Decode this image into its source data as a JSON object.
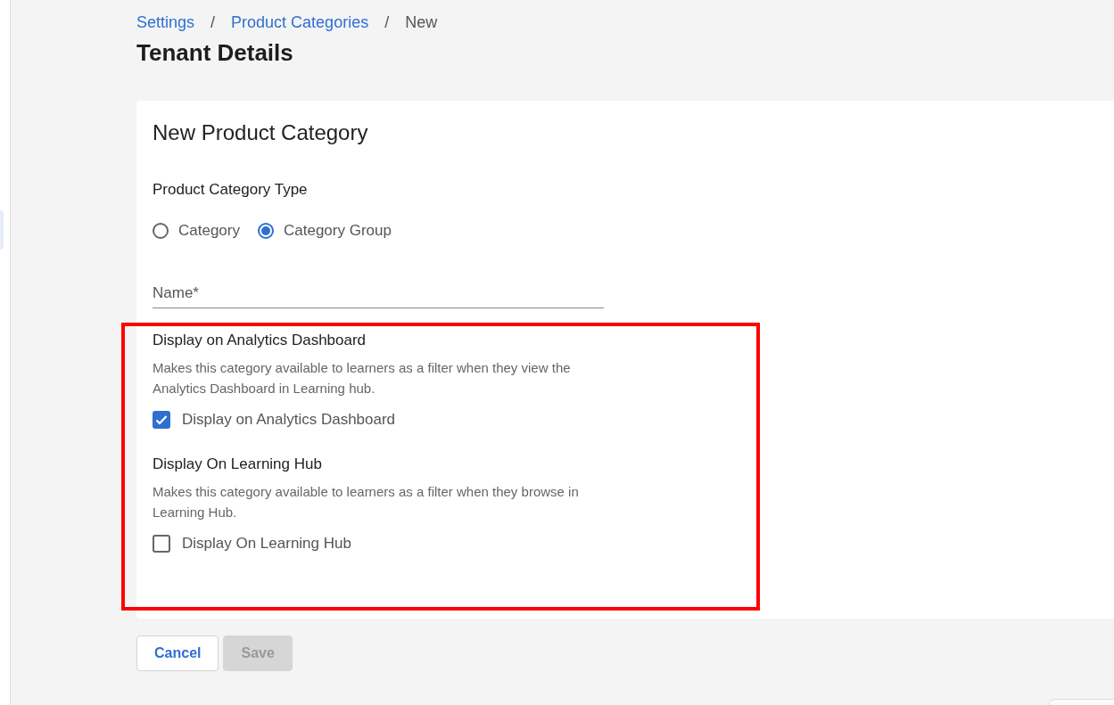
{
  "breadcrumb": [
    {
      "label": "Settings",
      "kind": "link"
    },
    {
      "label": "Product Categories",
      "kind": "link"
    },
    {
      "label": "New",
      "kind": "current"
    }
  ],
  "breadcrumb_separator": "/",
  "page_title": "Tenant Details",
  "card": {
    "title": "New Product Category",
    "type_field": {
      "label": "Product Category Type",
      "options": [
        {
          "label": "Category",
          "selected": false
        },
        {
          "label": "Category Group",
          "selected": true
        }
      ]
    },
    "name_field": {
      "placeholder": "Name*"
    },
    "sections": [
      {
        "heading": "Display on Analytics Dashboard",
        "description": "Makes this category available to learners as a filter when they view the Analytics Dashboard in Learning hub.",
        "checkbox": {
          "label": "Display on Analytics Dashboard",
          "checked": true
        }
      },
      {
        "heading": "Display On Learning Hub",
        "description": "Makes this category available to learners as a filter when they browse in Learning Hub.",
        "checkbox": {
          "label": "Display On Learning Hub",
          "checked": false
        }
      }
    ]
  },
  "buttons": [
    {
      "label": "Cancel",
      "disabled": false
    },
    {
      "label": "Save",
      "disabled": true
    }
  ]
}
